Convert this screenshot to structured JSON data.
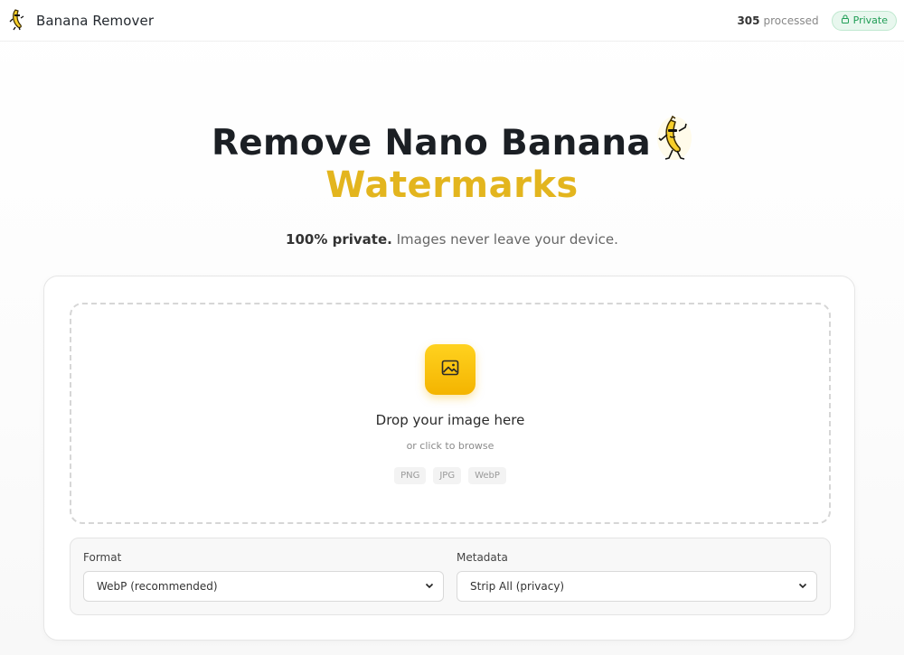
{
  "header": {
    "brand": "Banana Remover",
    "processed_count": "305",
    "processed_label": "processed",
    "private_label": "Private"
  },
  "hero": {
    "title_line1": "Remove Nano Banana",
    "title_line2": "Watermarks",
    "subtitle_bold": "100% private.",
    "subtitle_rest": " Images never leave your device."
  },
  "dropzone": {
    "title": "Drop your image here",
    "subtitle": "or click to browse",
    "formats": [
      "PNG",
      "JPG",
      "WebP"
    ]
  },
  "options": {
    "format_label": "Format",
    "format_value": "WebP (recommended)",
    "metadata_label": "Metadata",
    "metadata_value": "Strip All (privacy)"
  },
  "colors": {
    "accent_yellow": "#f4b400",
    "title_yellow": "#e3b51e",
    "private_green": "#1f9d55"
  }
}
